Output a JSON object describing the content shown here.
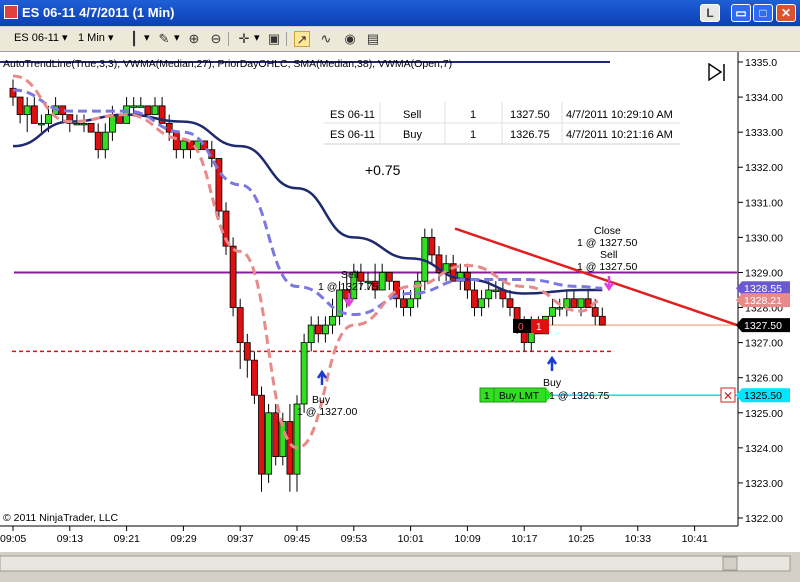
{
  "window": {
    "title": "ES 06-11   4/7/2011 (1 Min)",
    "minimize_label": "L",
    "maximize_label": "□",
    "close_label": "✕"
  },
  "toolbar": {
    "instrument": "ES 06-11",
    "interval": "1 Min",
    "dropdown_glyph": "▾"
  },
  "indicator_label": "AutoTrendLine(True,3,3), VWMA(Median,27), PriorDayOHLC, SMA(Median,38), VWMA(Open,7)",
  "executions_table": {
    "rows": [
      {
        "instrument": "ES 06-11",
        "action": "Sell",
        "qty": "1",
        "price": "1327.50",
        "time": "4/7/2011 10:29:10 AM"
      },
      {
        "instrument": "ES 06-11",
        "action": "Buy",
        "qty": "1",
        "price": "1326.75",
        "time": "4/7/2011 10:21:16 AM"
      }
    ]
  },
  "pnl_label": "+0.75",
  "annotations": {
    "sell1": "Sell",
    "sell1_qty": "1 @ 1327.75",
    "buy1": "Buy",
    "buy1_qty": "1 @ 1327.00",
    "close": "Close",
    "close_qty": "1 @ 1327.50",
    "sell2": "Sell",
    "sell2_qty": "1 @ 1327.50",
    "buy2": "Buy",
    "buy2_qty": "1 @ 1326.75"
  },
  "order_widgets": {
    "position_qty": "0",
    "position_pnl": "1",
    "buy_lmt_qty": "1",
    "buy_lmt_label": "Buy LMT",
    "buy_lmt_price": "1325.50",
    "cancel_glyph": "✕"
  },
  "copyright": "© 2011 NinjaTrader, LLC",
  "price_axis": {
    "ticks": [
      "1335.0",
      "1334.00",
      "1333.00",
      "1332.00",
      "1331.00",
      "1330.00",
      "1329.00",
      "1328.00",
      "1327.00",
      "1326.00",
      "1325.00",
      "1324.00",
      "1323.00",
      "1322.00"
    ],
    "markers": [
      {
        "label": "1328.55",
        "color": "#6a5acd"
      },
      {
        "label": "1328.21",
        "color": "#e88a8a"
      },
      {
        "label": "1327.50",
        "color": "#000000"
      },
      {
        "label": "1325.50",
        "color": "#00e5ff"
      }
    ]
  },
  "time_axis": {
    "ticks": [
      "09:05",
      "09:13",
      "09:21",
      "09:29",
      "09:37",
      "09:45",
      "09:53",
      "10:01",
      "10:09",
      "10:17",
      "10:25",
      "10:33",
      "10:41"
    ]
  },
  "colors": {
    "up_bar": "#33dd22",
    "down_bar": "#dd1111",
    "sma": "#1f2a6e",
    "vwma_median": "#7b78e0",
    "vwma_open": "#e88a8a",
    "trendline": "#e02020",
    "prior_day": "#8a1aa0",
    "prior_low": "#dd1111"
  },
  "chart_data": {
    "type": "candlestick",
    "instrument": "ES 06-11",
    "interval": "1 Min",
    "date": "4/7/2011",
    "ylim": [
      1322.0,
      1335.0
    ],
    "x_ticks": [
      "09:05",
      "09:13",
      "09:21",
      "09:29",
      "09:37",
      "09:45",
      "09:53",
      "10:01",
      "10:09",
      "10:17",
      "10:25",
      "10:33",
      "10:41"
    ],
    "first_bar": "09:05",
    "last_bar": "10:30",
    "candles": [
      [
        1334.25,
        1334.5,
        1333.75,
        1334.0
      ],
      [
        1334.0,
        1334.0,
        1333.25,
        1333.5
      ],
      [
        1333.5,
        1334.0,
        1333.0,
        1333.75
      ],
      [
        1333.75,
        1334.0,
        1333.25,
        1333.25
      ],
      [
        1333.25,
        1333.5,
        1333.0,
        1333.25
      ],
      [
        1333.25,
        1333.75,
        1333.0,
        1333.5
      ],
      [
        1333.5,
        1334.0,
        1333.5,
        1333.75
      ],
      [
        1333.75,
        1333.75,
        1333.25,
        1333.5
      ],
      [
        1333.5,
        1333.5,
        1333.0,
        1333.25
      ],
      [
        1333.25,
        1333.5,
        1333.25,
        1333.25
      ],
      [
        1333.25,
        1333.5,
        1333.0,
        1333.25
      ],
      [
        1333.25,
        1333.25,
        1333.0,
        1333.0
      ],
      [
        1333.0,
        1333.25,
        1332.25,
        1332.5
      ],
      [
        1332.5,
        1333.25,
        1332.25,
        1333.0
      ],
      [
        1333.0,
        1333.75,
        1332.75,
        1333.5
      ],
      [
        1333.5,
        1333.5,
        1333.25,
        1333.25
      ],
      [
        1333.25,
        1334.0,
        1333.25,
        1333.75
      ],
      [
        1333.75,
        1334.0,
        1333.5,
        1333.75
      ],
      [
        1333.75,
        1334.0,
        1333.75,
        1333.75
      ],
      [
        1333.75,
        1333.75,
        1333.5,
        1333.5
      ],
      [
        1333.5,
        1334.0,
        1333.5,
        1333.75
      ],
      [
        1333.75,
        1334.0,
        1333.25,
        1333.25
      ],
      [
        1333.25,
        1333.5,
        1332.75,
        1333.0
      ],
      [
        1333.0,
        1333.0,
        1332.25,
        1332.5
      ],
      [
        1332.5,
        1332.75,
        1332.25,
        1332.75
      ],
      [
        1332.75,
        1332.75,
        1332.25,
        1332.5
      ],
      [
        1332.5,
        1332.75,
        1332.5,
        1332.75
      ],
      [
        1332.75,
        1332.75,
        1332.5,
        1332.5
      ],
      [
        1332.5,
        1332.75,
        1332.0,
        1332.25
      ],
      [
        1332.25,
        1332.25,
        1330.5,
        1330.75
      ],
      [
        1330.75,
        1331.0,
        1329.5,
        1329.75
      ],
      [
        1329.75,
        1330.0,
        1327.75,
        1328.0
      ],
      [
        1328.0,
        1328.25,
        1326.25,
        1327.0
      ],
      [
        1327.0,
        1327.25,
        1326.0,
        1326.5
      ],
      [
        1326.5,
        1326.75,
        1325.25,
        1325.5
      ],
      [
        1325.5,
        1325.75,
        1322.75,
        1323.25
      ],
      [
        1323.25,
        1325.25,
        1323.0,
        1325.0
      ],
      [
        1325.0,
        1325.25,
        1323.5,
        1323.75
      ],
      [
        1323.75,
        1325.0,
        1323.5,
        1324.75
      ],
      [
        1324.75,
        1325.25,
        1322.75,
        1323.25
      ],
      [
        1323.25,
        1325.5,
        1322.75,
        1325.25
      ],
      [
        1325.25,
        1327.25,
        1325.0,
        1327.0
      ],
      [
        1327.0,
        1327.75,
        1326.75,
        1327.5
      ],
      [
        1327.5,
        1327.75,
        1327.0,
        1327.25
      ],
      [
        1327.25,
        1327.75,
        1327.0,
        1327.5
      ],
      [
        1327.5,
        1328.25,
        1327.25,
        1327.75
      ],
      [
        1327.75,
        1328.75,
        1327.5,
        1328.5
      ],
      [
        1328.5,
        1329.0,
        1328.0,
        1328.25
      ],
      [
        1328.25,
        1329.25,
        1328.25,
        1329.0
      ],
      [
        1329.0,
        1329.25,
        1328.5,
        1328.75
      ],
      [
        1328.75,
        1329.0,
        1328.5,
        1328.75
      ],
      [
        1328.75,
        1329.25,
        1328.25,
        1328.5
      ],
      [
        1328.5,
        1329.25,
        1328.5,
        1329.0
      ],
      [
        1329.0,
        1329.0,
        1328.5,
        1328.75
      ],
      [
        1328.75,
        1328.75,
        1328.0,
        1328.25
      ],
      [
        1328.25,
        1328.5,
        1327.75,
        1328.0
      ],
      [
        1328.0,
        1328.5,
        1327.75,
        1328.25
      ],
      [
        1328.25,
        1329.0,
        1328.0,
        1328.75
      ],
      [
        1328.75,
        1330.25,
        1328.5,
        1330.0
      ],
      [
        1330.0,
        1330.25,
        1329.25,
        1329.5
      ],
      [
        1329.5,
        1329.75,
        1328.75,
        1329.0
      ],
      [
        1329.0,
        1329.5,
        1328.75,
        1329.25
      ],
      [
        1329.25,
        1329.5,
        1328.75,
        1328.75
      ],
      [
        1328.75,
        1329.25,
        1328.5,
        1329.0
      ],
      [
        1329.0,
        1329.25,
        1328.25,
        1328.5
      ],
      [
        1328.5,
        1328.75,
        1327.75,
        1328.0
      ],
      [
        1328.0,
        1328.5,
        1327.75,
        1328.25
      ],
      [
        1328.25,
        1328.75,
        1328.0,
        1328.5
      ],
      [
        1328.5,
        1328.75,
        1328.25,
        1328.5
      ],
      [
        1328.5,
        1328.75,
        1328.0,
        1328.25
      ],
      [
        1328.25,
        1328.5,
        1327.75,
        1328.0
      ],
      [
        1328.0,
        1328.0,
        1327.25,
        1327.5
      ],
      [
        1327.5,
        1327.75,
        1326.75,
        1327.0
      ],
      [
        1327.0,
        1327.75,
        1326.75,
        1327.5
      ],
      [
        1327.5,
        1327.75,
        1327.25,
        1327.25
      ],
      [
        1327.25,
        1327.75,
        1327.25,
        1327.75
      ],
      [
        1327.75,
        1328.25,
        1327.5,
        1328.0
      ],
      [
        1328.0,
        1328.25,
        1327.75,
        1328.0
      ],
      [
        1328.0,
        1328.5,
        1327.75,
        1328.25
      ],
      [
        1328.25,
        1328.5,
        1328.0,
        1328.0
      ],
      [
        1328.0,
        1328.25,
        1327.75,
        1328.25
      ],
      [
        1328.25,
        1328.5,
        1328.0,
        1328.0
      ],
      [
        1328.0,
        1328.25,
        1327.5,
        1327.75
      ],
      [
        1327.75,
        1328.0,
        1327.5,
        1327.5
      ]
    ],
    "series": [
      {
        "name": "SMA(Median,38)",
        "x_ticks_index": [
          0,
          8,
          16,
          24,
          32,
          40,
          48,
          56,
          64,
          72,
          80,
          83
        ],
        "values": [
          1332.6,
          1333.3,
          1333.5,
          1333.3,
          1332.6,
          1331.4,
          1330.0,
          1329.4,
          1328.8,
          1328.4,
          1328.5,
          1328.5
        ]
      },
      {
        "name": "VWMA(Median,27)",
        "x_ticks_index": [
          0,
          8,
          16,
          24,
          32,
          40,
          48,
          56,
          64,
          72,
          80,
          83
        ],
        "values": [
          1334.2,
          1333.6,
          1333.6,
          1333.0,
          1331.5,
          1328.6,
          1327.8,
          1328.4,
          1328.8,
          1328.8,
          1328.6,
          1328.55
        ]
      },
      {
        "name": "VWMA(Open,7)",
        "x_ticks_index": [
          0,
          8,
          16,
          24,
          32,
          40,
          48,
          56,
          64,
          72,
          80,
          83
        ],
        "values": [
          1334.6,
          1333.3,
          1333.5,
          1332.8,
          1329.6,
          1324.0,
          1327.5,
          1328.6,
          1329.2,
          1328.6,
          1327.9,
          1328.21
        ]
      }
    ],
    "lines": {
      "prior_day_level": 1329.0,
      "prior_day_low_dashed": 1326.75,
      "trendline": {
        "from_price": 1330.25,
        "to_price": 1327.5
      },
      "position_price": 1327.5,
      "buy_limit_price": 1325.5
    },
    "executions": [
      {
        "action": "Sell",
        "price": 1327.75,
        "time": "09:52"
      },
      {
        "action": "Buy",
        "price": 1327.0,
        "time": "09:46"
      },
      {
        "action": "Buy",
        "price": 1326.75,
        "time": "10:21"
      },
      {
        "action": "Sell",
        "price": 1327.5,
        "time": "10:29"
      }
    ]
  }
}
